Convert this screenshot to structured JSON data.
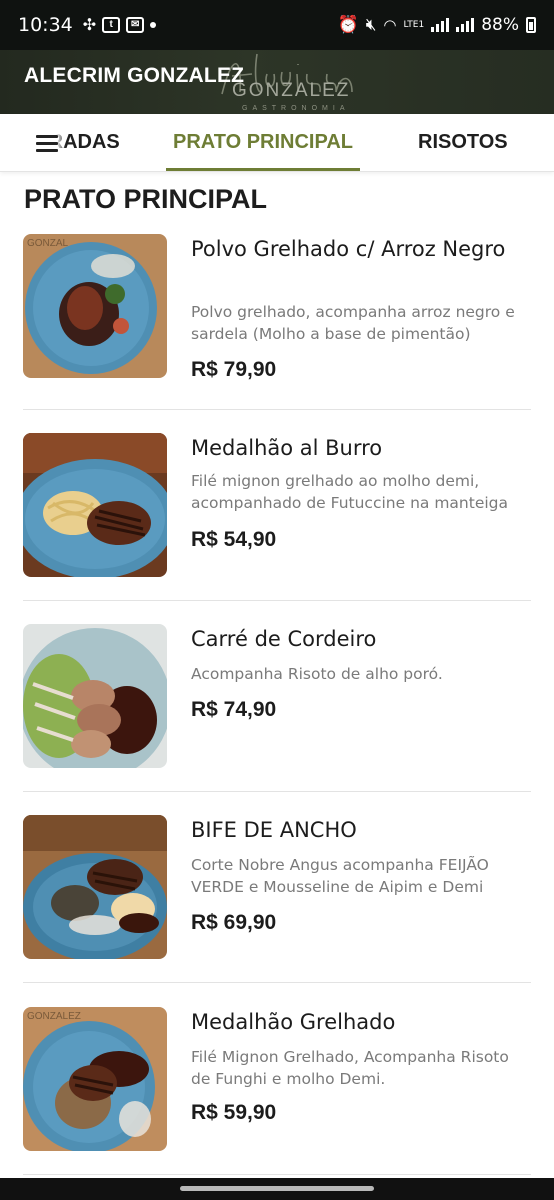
{
  "status_bar": {
    "time": "10:34",
    "battery": "88%",
    "network": "LTE1"
  },
  "header": {
    "title": "ALECRIM GONZALEZ",
    "logo_text": "Alecrim",
    "logo_subtitle": "GONZALEZ",
    "logo_tagline": "GASTRONOMIA"
  },
  "tabs": [
    {
      "label": "ENTRADAS",
      "visible_text": ":RADAS",
      "active": false
    },
    {
      "label": "PRATO PRINCIPAL",
      "active": true
    },
    {
      "label": "RISOTOS",
      "active": false
    }
  ],
  "colors": {
    "accent": "#6e7d35",
    "header_bg": "#2d3527",
    "plate_blue": "#4f8fb3"
  },
  "section": {
    "title": "PRATO PRINCIPAL"
  },
  "items": [
    {
      "name": "Polvo Grelhado c/ Arroz Negro",
      "description": "Polvo grelhado, acompanha arroz negro e sardela (Molho a base de pimentão)",
      "price": "R$ 79,90",
      "image": "octopus-plate-icon"
    },
    {
      "name": "Medalhão al Burro",
      "description": "Filé mignon grelhado ao molho demi, acompanhado de Futuccine na manteiga",
      "price": "R$ 54,90",
      "image": "steak-pasta-plate-icon"
    },
    {
      "name": "Carré de Cordeiro",
      "description": "Acompanha Risoto de alho poró.",
      "price": "R$ 74,90",
      "image": "lamb-rack-plate-icon"
    },
    {
      "name": "BIFE DE ANCHO",
      "description": "Corte Nobre Angus acompanha FEIJÃO VERDE e Mousseline de Aipim e Demi",
      "price": "R$ 69,90",
      "image": "ancho-steak-plate-icon"
    },
    {
      "name": "Medalhão Grelhado",
      "description": "Filé Mignon Grelhado, Acompanha Risoto de Funghi e molho Demi.",
      "price": "R$ 59,90",
      "image": "grilled-medallion-plate-icon"
    }
  ]
}
